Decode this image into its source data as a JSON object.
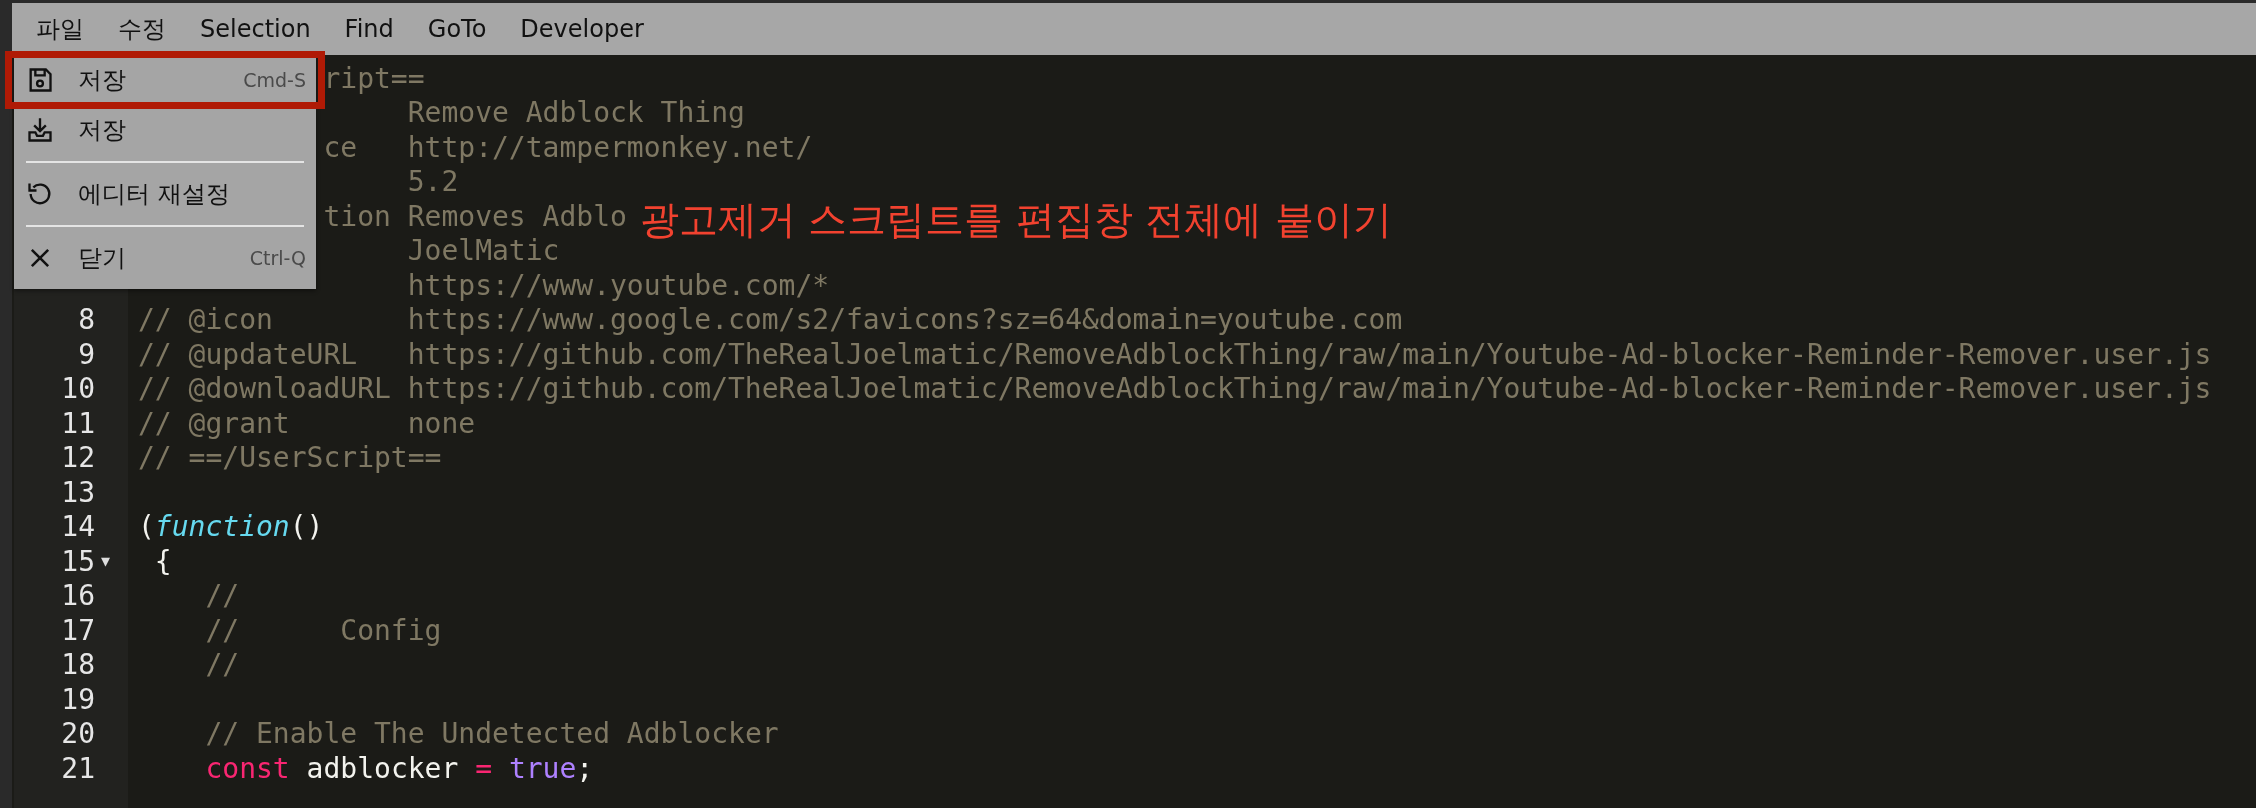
{
  "menu_bar": [
    {
      "label": "파일"
    },
    {
      "label": "수정"
    },
    {
      "label": "Selection"
    },
    {
      "label": "Find"
    },
    {
      "label": "GoTo"
    },
    {
      "label": "Developer"
    }
  ],
  "file_menu": {
    "items": [
      {
        "kind": "save",
        "label": "저장",
        "shortcut": "Cmd-S",
        "highlighted": true
      },
      {
        "kind": "download",
        "label": "저장",
        "highlighted": false
      },
      {
        "kind": "separator"
      },
      {
        "kind": "reset",
        "label": "에디터 재설정",
        "highlighted": false
      },
      {
        "kind": "separator"
      },
      {
        "kind": "close",
        "label": "닫기",
        "shortcut": "Ctrl-Q",
        "highlighted": false
      }
    ]
  },
  "editor": {
    "partial_lines": [
      {
        "key": "ript=="
      },
      {
        "value": "Remove Adblock Thing"
      },
      {
        "key": "ce",
        "value": "http://tampermonkey.net/"
      },
      {
        "value": "5.2"
      },
      {
        "key": "tion",
        "value": "Removes Adblo"
      },
      {
        "value": "JoelMatic"
      },
      {
        "value": "https://www.youtube.com/*"
      }
    ],
    "lines": [
      {
        "number": "8",
        "tokens": [
          {
            "kind": "meta-key",
            "text": "// @icon"
          },
          {
            "kind": "comment",
            "text": "https://www.google.com/s2/favicons?sz=64&domain=youtube.com"
          }
        ]
      },
      {
        "number": "9",
        "tokens": [
          {
            "kind": "meta-key",
            "text": "// @updateURL"
          },
          {
            "kind": "comment",
            "text": "https://github.com/TheRealJoelmatic/RemoveAdblockThing/raw/main/Youtube-Ad-blocker-Reminder-Remover.user.js"
          }
        ]
      },
      {
        "number": "10",
        "tokens": [
          {
            "kind": "meta-key",
            "text": "// @downloadURL"
          },
          {
            "kind": "comment",
            "text": "https://github.com/TheRealJoelmatic/RemoveAdblockThing/raw/main/Youtube-Ad-blocker-Reminder-Remover.user.js"
          }
        ]
      },
      {
        "number": "11",
        "tokens": [
          {
            "kind": "meta-key",
            "text": "// @grant"
          },
          {
            "kind": "comment",
            "text": "none"
          }
        ]
      },
      {
        "number": "12",
        "tokens": [
          {
            "kind": "comment",
            "text": "// ==/UserScript=="
          }
        ]
      },
      {
        "number": "13"
      },
      {
        "number": "14",
        "tokens": [
          {
            "kind": "plain",
            "text": "("
          },
          {
            "kind": "storage",
            "text": "function"
          },
          {
            "kind": "plain",
            "text": "()"
          }
        ]
      },
      {
        "number": "15",
        "fold": "▼",
        "tokens": [
          {
            "kind": "plain",
            "text": " {"
          }
        ]
      },
      {
        "number": "16",
        "tokens": [
          {
            "kind": "comment",
            "text": "    //"
          }
        ]
      },
      {
        "number": "17",
        "tokens": [
          {
            "kind": "comment",
            "text": "    //      Config"
          }
        ]
      },
      {
        "number": "18",
        "tokens": [
          {
            "kind": "comment",
            "text": "    //"
          }
        ]
      },
      {
        "number": "19"
      },
      {
        "number": "20",
        "tokens": [
          {
            "kind": "comment",
            "text": "    // Enable The Undetected Adblocker"
          }
        ]
      },
      {
        "number": "21",
        "tokens": [
          {
            "kind": "keyword",
            "text": "    const"
          },
          {
            "kind": "plain",
            "text": " adblocker "
          },
          {
            "kind": "keyword",
            "text": "="
          },
          {
            "kind": "constant",
            "text": " true"
          },
          {
            "kind": "plain",
            "text": ";"
          }
        ]
      }
    ]
  },
  "annotation": {
    "text": "광고제거 스크립트를 편집창 전체에 붙이기"
  }
}
